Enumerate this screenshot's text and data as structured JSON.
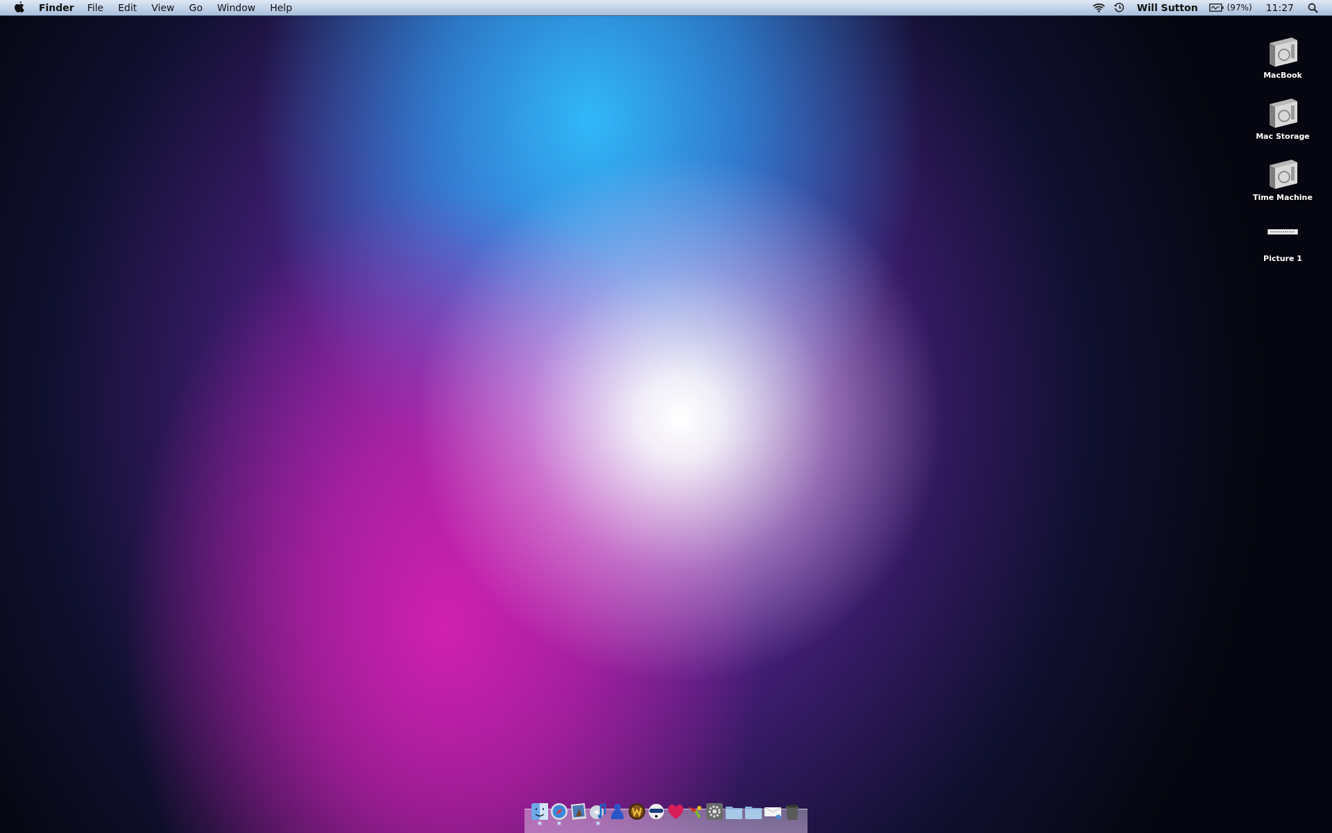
{
  "menu_bar": {
    "app_name": "Finder",
    "menus": [
      "File",
      "Edit",
      "View",
      "Go",
      "Window",
      "Help"
    ],
    "user": "Will Sutton",
    "battery": "(97%)",
    "clock": "11:27"
  },
  "desktop_icons": [
    {
      "kind": "drive",
      "label": "MacBook"
    },
    {
      "kind": "drive",
      "label": "Mac Storage"
    },
    {
      "kind": "drive",
      "label": "Time Machine"
    },
    {
      "kind": "picture",
      "label": "Picture 1"
    }
  ],
  "dock": [
    {
      "kind": "finder",
      "running": true
    },
    {
      "kind": "compass",
      "running": true
    },
    {
      "kind": "photo",
      "running": false
    },
    {
      "kind": "music",
      "running": true
    },
    {
      "kind": "person",
      "running": false
    },
    {
      "kind": "emblem",
      "running": false
    },
    {
      "kind": "helmet",
      "running": false
    },
    {
      "kind": "heart",
      "running": false
    },
    {
      "kind": "spray",
      "running": false
    },
    {
      "kind": "gear",
      "running": false
    },
    {
      "kind": "folder",
      "running": false
    },
    {
      "kind": "folder",
      "running": false
    },
    {
      "kind": "envelope",
      "running": false
    },
    {
      "kind": "trash",
      "running": false
    }
  ]
}
